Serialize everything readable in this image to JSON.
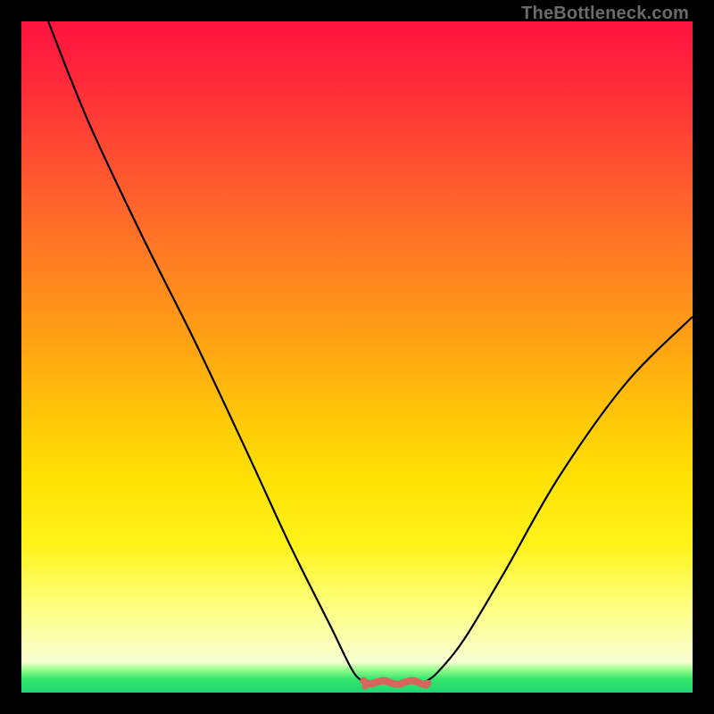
{
  "watermark": "TheBottleneck.com",
  "colors": {
    "frame": "#000000",
    "curve": "#000000",
    "marker": "#d9645d",
    "gradient_top": "#ff153f",
    "gradient_bottom": "#1fd873"
  },
  "chart_data": {
    "type": "line",
    "title": "",
    "xlabel": "",
    "ylabel": "",
    "xlim": [
      0,
      100
    ],
    "ylim": [
      0,
      100
    ],
    "series": [
      {
        "name": "left-branch",
        "x": [
          4,
          10,
          18,
          26,
          34,
          40,
          46,
          49.5,
          51.5
        ],
        "y": [
          100,
          85,
          68,
          52,
          35,
          22,
          10,
          3,
          1.5
        ]
      },
      {
        "name": "right-branch",
        "x": [
          60,
          62,
          66,
          72,
          80,
          90,
          100
        ],
        "y": [
          1.5,
          3,
          8,
          18,
          32,
          46,
          56
        ]
      }
    ],
    "annotations": [
      {
        "name": "minimum-marker",
        "x_range": [
          51.5,
          60
        ],
        "y": 1.5,
        "color": "#d9645d"
      }
    ]
  }
}
